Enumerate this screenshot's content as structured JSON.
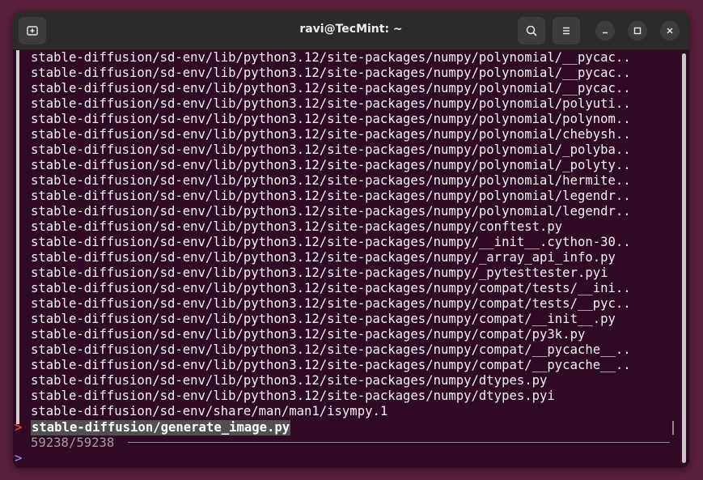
{
  "window": {
    "title": "ravi@TecMint: ~",
    "new_tab_icon": "new-tab-icon",
    "search_icon": "search-icon",
    "menu_icon": "hamburger-menu-icon",
    "minimize_icon": "minimize-icon",
    "maximize_icon": "maximize-icon",
    "close_icon": "close-icon"
  },
  "terminal": {
    "lines": [
      "stable-diffusion/sd-env/lib/python3.12/site-packages/numpy/polynomial/__pycac..",
      "stable-diffusion/sd-env/lib/python3.12/site-packages/numpy/polynomial/__pycac..",
      "stable-diffusion/sd-env/lib/python3.12/site-packages/numpy/polynomial/__pycac..",
      "stable-diffusion/sd-env/lib/python3.12/site-packages/numpy/polynomial/polyuti..",
      "stable-diffusion/sd-env/lib/python3.12/site-packages/numpy/polynomial/polynom..",
      "stable-diffusion/sd-env/lib/python3.12/site-packages/numpy/polynomial/chebysh..",
      "stable-diffusion/sd-env/lib/python3.12/site-packages/numpy/polynomial/_polyba..",
      "stable-diffusion/sd-env/lib/python3.12/site-packages/numpy/polynomial/_polyty..",
      "stable-diffusion/sd-env/lib/python3.12/site-packages/numpy/polynomial/hermite..",
      "stable-diffusion/sd-env/lib/python3.12/site-packages/numpy/polynomial/legendr..",
      "stable-diffusion/sd-env/lib/python3.12/site-packages/numpy/polynomial/legendr..",
      "stable-diffusion/sd-env/lib/python3.12/site-packages/numpy/conftest.py",
      "stable-diffusion/sd-env/lib/python3.12/site-packages/numpy/__init__.cython-30..",
      "stable-diffusion/sd-env/lib/python3.12/site-packages/numpy/_array_api_info.py",
      "stable-diffusion/sd-env/lib/python3.12/site-packages/numpy/_pytesttester.pyi",
      "stable-diffusion/sd-env/lib/python3.12/site-packages/numpy/compat/tests/__ini..",
      "stable-diffusion/sd-env/lib/python3.12/site-packages/numpy/compat/tests/__pyc..",
      "stable-diffusion/sd-env/lib/python3.12/site-packages/numpy/compat/__init__.py",
      "stable-diffusion/sd-env/lib/python3.12/site-packages/numpy/compat/py3k.py",
      "stable-diffusion/sd-env/lib/python3.12/site-packages/numpy/compat/__pycache__..",
      "stable-diffusion/sd-env/lib/python3.12/site-packages/numpy/compat/__pycache__..",
      "stable-diffusion/sd-env/lib/python3.12/site-packages/numpy/dtypes.py",
      "stable-diffusion/sd-env/lib/python3.12/site-packages/numpy/dtypes.pyi",
      "stable-diffusion/sd-env/share/man/man1/isympy.1"
    ],
    "selected": {
      "pointer": ">",
      "text": "stable-diffusion/generate_image.py"
    },
    "match_count": "59238/59238",
    "prompt": ">"
  },
  "colors": {
    "desktop_bg": "#5a1f3c",
    "terminal_bg": "#300a24",
    "titlebar_bg": "#2b2b2b",
    "pointer": "#e0403a",
    "prompt": "#9a9aff"
  }
}
